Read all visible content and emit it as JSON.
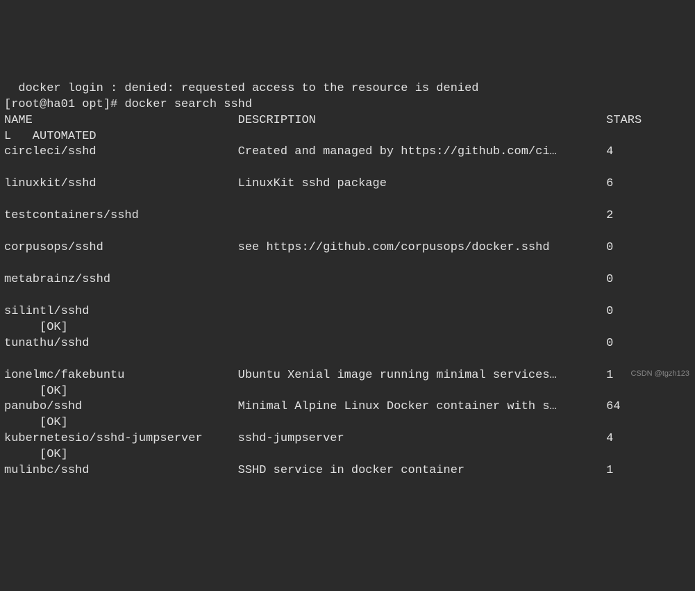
{
  "error_line": "  docker login : denied: requested access to the resource is denied",
  "prompt": "[root@ha01 opt]# ",
  "command": "docker search sshd",
  "headers": {
    "name": "NAME",
    "description": "DESCRIPTION",
    "stars": "STARS",
    "official_prefix": "L",
    "automated": "AUTOMATED"
  },
  "rows": [
    {
      "name": "circleci/sshd",
      "desc": "Created and managed by https://github.com/ci…",
      "stars": "4",
      "ok": false
    },
    {
      "name": "linuxkit/sshd",
      "desc": "LinuxKit sshd package",
      "stars": "6",
      "ok": false
    },
    {
      "name": "testcontainers/sshd",
      "desc": "",
      "stars": "2",
      "ok": false
    },
    {
      "name": "corpusops/sshd",
      "desc": "see https://github.com/corpusops/docker.sshd",
      "stars": "0",
      "ok": false
    },
    {
      "name": "metabrainz/sshd",
      "desc": "",
      "stars": "0",
      "ok": false
    },
    {
      "name": "silintl/sshd",
      "desc": "",
      "stars": "0",
      "ok": true
    },
    {
      "name": "tunathu/sshd",
      "desc": "",
      "stars": "0",
      "ok": false
    },
    {
      "name": "ionelmc/fakebuntu",
      "desc": "Ubuntu Xenial image running minimal services…",
      "stars": "1",
      "ok": true
    },
    {
      "name": "panubo/sshd",
      "desc": "Minimal Alpine Linux Docker container with s…",
      "stars": "64",
      "ok": true
    },
    {
      "name": "kubernetesio/sshd-jumpserver",
      "desc": "sshd-jumpserver",
      "stars": "4",
      "ok": true
    },
    {
      "name": "mulinbc/sshd",
      "desc": "SSHD service in docker container",
      "stars": "1",
      "ok": false
    }
  ],
  "ok_text": "[OK]",
  "watermark": "CSDN @tgzh123",
  "col_name_w": 33,
  "col_desc_w": 52,
  "col_stars_w": 5,
  "ok_indent": "     "
}
